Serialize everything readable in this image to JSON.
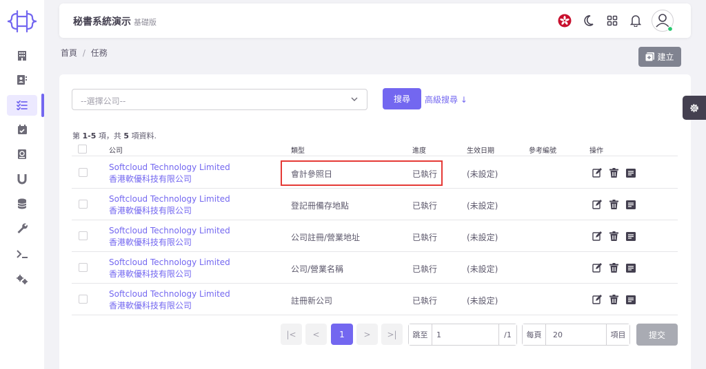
{
  "app": {
    "title": "秘書系統演示",
    "subtitle": "基礎版"
  },
  "sidebar": {
    "items": [
      {
        "icon": "building-icon"
      },
      {
        "icon": "contact-book-icon"
      },
      {
        "icon": "checklist-icon",
        "active": true
      },
      {
        "icon": "calendar-check-icon"
      },
      {
        "icon": "email-icon"
      },
      {
        "icon": "magnet-icon"
      },
      {
        "icon": "database-icon"
      },
      {
        "icon": "wrench-icon"
      },
      {
        "icon": "terminal-icon"
      },
      {
        "icon": "gears-icon"
      }
    ]
  },
  "header": {
    "icons": [
      "hk-flag-icon",
      "moon-icon",
      "apps-grid-icon",
      "bell-icon",
      "user-avatar-icon"
    ]
  },
  "breadcrumb": {
    "home": "首頁",
    "separator": "/",
    "current": "任務"
  },
  "toolbar": {
    "create_label": "建立",
    "search_label": "搜尋",
    "advanced_label": "高級搜尋 ↓"
  },
  "filter": {
    "company_placeholder": "--選擇公司--"
  },
  "summary": {
    "prefix": "第 ",
    "range": "1-5",
    "middle": " 項，共 ",
    "total": "5",
    "suffix": " 項資料."
  },
  "table": {
    "headers": {
      "company": "公司",
      "type": "類型",
      "progress": "進度",
      "effective_date": "生效日期",
      "reference": "參考編號",
      "actions": "操作"
    },
    "rows": [
      {
        "company_en": "Softcloud Technology Limited",
        "company_zh": "香港軟優科技有限公司",
        "type": "會計參照日",
        "progress": "已執行",
        "effective_date": "(未設定)"
      },
      {
        "company_en": "Softcloud Technology Limited",
        "company_zh": "香港軟優科技有限公司",
        "type": "登記冊備存地點",
        "progress": "已執行",
        "effective_date": "(未設定)"
      },
      {
        "company_en": "Softcloud Technology Limited",
        "company_zh": "香港軟優科技有限公司",
        "type": "公司註冊/營業地址",
        "progress": "已執行",
        "effective_date": "(未設定)"
      },
      {
        "company_en": "Softcloud Technology Limited",
        "company_zh": "香港軟優科技有限公司",
        "type": "公司/營業名稱",
        "progress": "已執行",
        "effective_date": "(未設定)"
      },
      {
        "company_en": "Softcloud Technology Limited",
        "company_zh": "香港軟優科技有限公司",
        "type": "註冊新公司",
        "progress": "已執行",
        "effective_date": "(未設定)"
      }
    ]
  },
  "pagination": {
    "first": "|<",
    "prev": "<",
    "current": "1",
    "next": ">",
    "last": ">|",
    "jump_label": "跳至",
    "jump_value": "1",
    "total_pages": "/1",
    "per_page_label": "每頁",
    "per_page_value": "20",
    "items_label": "項目",
    "submit_label": "提交"
  },
  "colors": {
    "primary": "#7367f0",
    "secondary": "#808390",
    "highlight": "#e53935"
  }
}
